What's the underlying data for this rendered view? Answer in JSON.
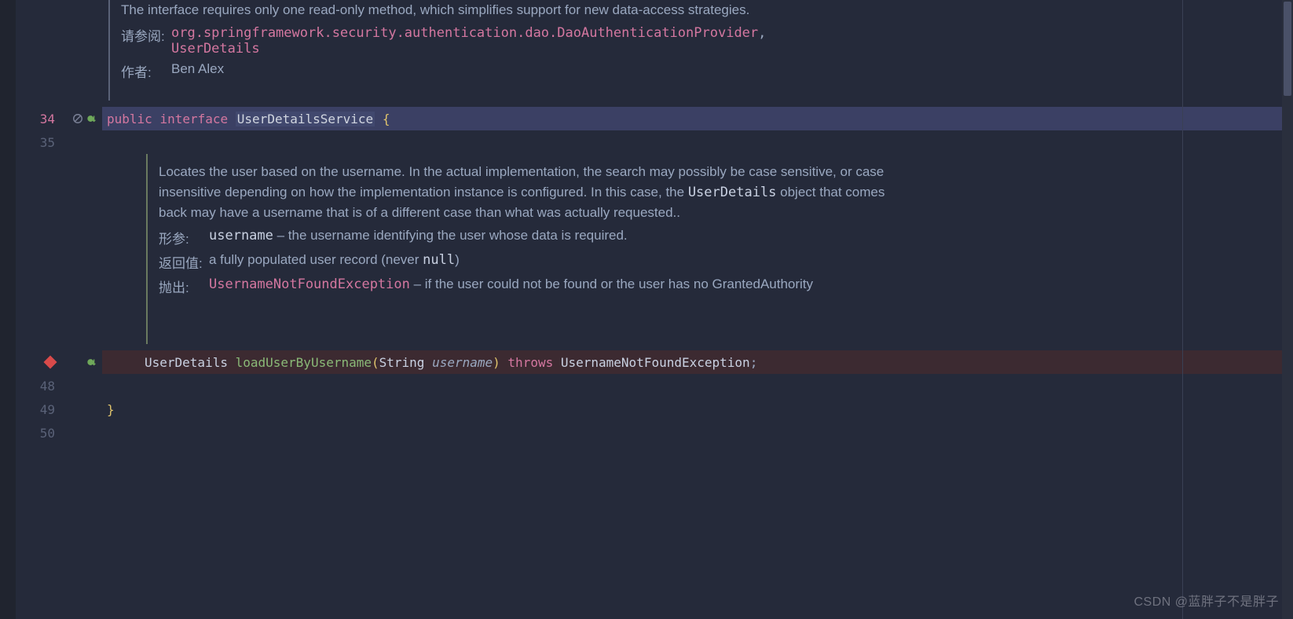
{
  "doc_top": {
    "partial_text": "The interface requires only one read-only method, which simplifies support for new data-access strategies.",
    "see_label": "请参阅:",
    "see_refs": "org.springframework.security.authentication.dao.DaoAuthenticationProvider",
    "see_comma": ",",
    "see_ref2": "UserDetails",
    "author_label": "作者:",
    "author_value": "Ben Alex"
  },
  "line34": {
    "number": "34",
    "kw_public": "public",
    "kw_interface": "interface",
    "name": "UserDetailsService",
    "brace": "{"
  },
  "line35": {
    "number": "35"
  },
  "doc_method": {
    "para_a": "Locates the user based on the username. In the actual implementation, the search may possibly be case sensitive, or case insensitive depending on how the implementation instance is configured. In this case, the ",
    "para_code": "UserDetails",
    "para_b": " object that comes back may have a username that is of a different case than what was actually requested..",
    "params_label": "形参:",
    "params_name": "username",
    "params_desc": " – the username identifying the user whose data is required.",
    "return_label": "返回值:",
    "return_desc_a": "a fully populated user record (never ",
    "return_code": "null",
    "return_desc_b": ")",
    "throws_label": "抛出:",
    "throws_name": "UsernameNotFoundException",
    "throws_desc": " – if the user could not be found or the user has no GrantedAuthority"
  },
  "sig": {
    "ret": "UserDetails",
    "method": "loadUserByUsername",
    "lp": "(",
    "ptype": "String",
    "pname": "username",
    "rp": ")",
    "throws_kw": "throws",
    "exc": "UsernameNotFoundException",
    "semi": ";"
  },
  "line48": {
    "number": "48"
  },
  "line49": {
    "number": "49",
    "brace": "}"
  },
  "line50": {
    "number": "50"
  },
  "watermark": "CSDN @蓝胖子不是胖子"
}
